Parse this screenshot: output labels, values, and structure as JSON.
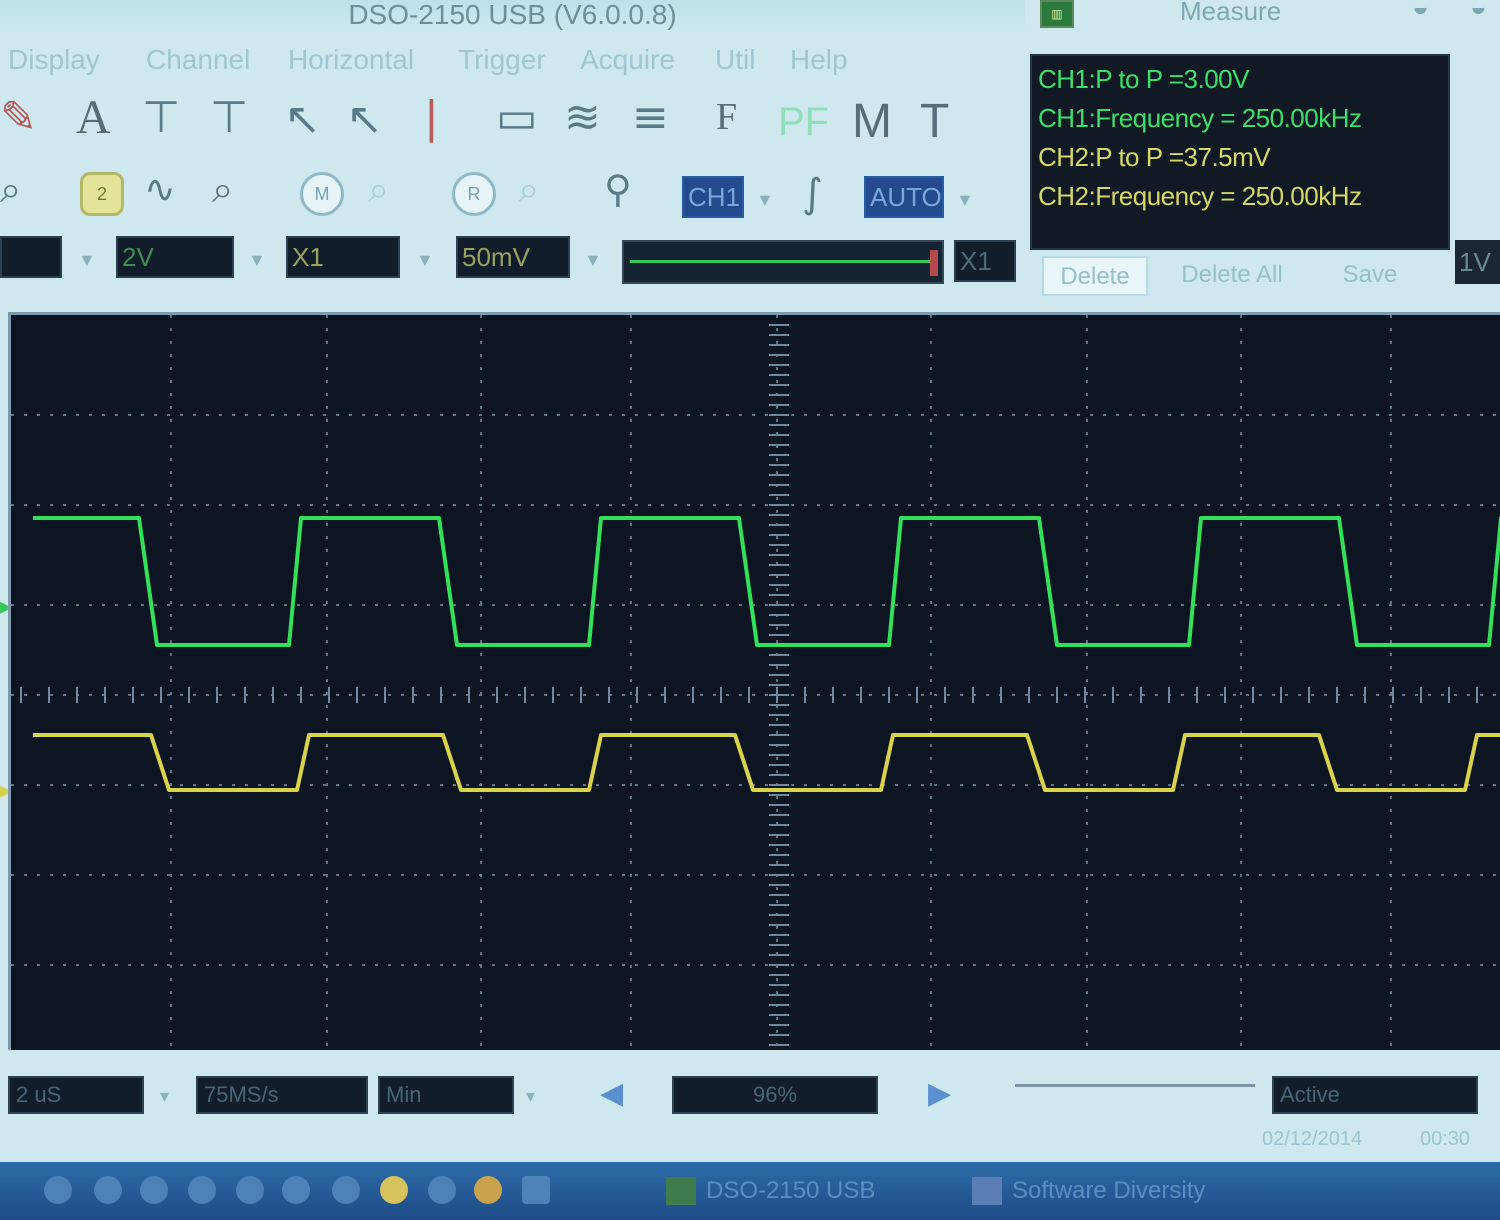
{
  "window": {
    "title": "DSO-2150 USB (V6.0.0.8)"
  },
  "menu": [
    "Display",
    "Channel",
    "Horizontal",
    "Trigger",
    "Acquire",
    "Util",
    "Help"
  ],
  "toolbar": {
    "text_tool": "A",
    "freq_tool": "F",
    "pf_tool": "PF",
    "math_tool": "M",
    "timebase_tool": "T",
    "mem_m": "M",
    "mem_r": "R",
    "cursor_2": "2"
  },
  "trigger": {
    "source": "CH1",
    "mode": "AUTO"
  },
  "channels": {
    "ch1_volts_div": "2V",
    "ch1_probe": "X1",
    "ch2_volts_div": "50mV",
    "ch2_probe": "X1",
    "ch2_ref": "1V"
  },
  "measure": {
    "title": "Measure",
    "lines": [
      {
        "text": "CH1:P to P =3.00V",
        "channel": "ch1"
      },
      {
        "text": "CH1:Frequency = 250.00kHz",
        "channel": "ch1"
      },
      {
        "text": "CH2:P to P =37.5mV",
        "channel": "ch2"
      },
      {
        "text": "CH2:Frequency = 250.00kHz",
        "channel": "ch2"
      }
    ],
    "buttons": {
      "delete": "Delete",
      "delete_all": "Delete All",
      "save": "Save"
    }
  },
  "bottom": {
    "time_div": "2 uS",
    "sample_rate": "75MS/s",
    "acq_mode": "Min",
    "zoom": "96%",
    "status": "Active",
    "date": "02/12/2014",
    "time": "00:30"
  },
  "taskbar": {
    "app1": "DSO-2150 USB",
    "app2": "Software Diversity"
  },
  "colors": {
    "ch1_trace": "#32e05a",
    "ch2_trace": "#d9d34c",
    "screen_bg": "#0e1522",
    "grid": "#6f8aa0"
  }
}
